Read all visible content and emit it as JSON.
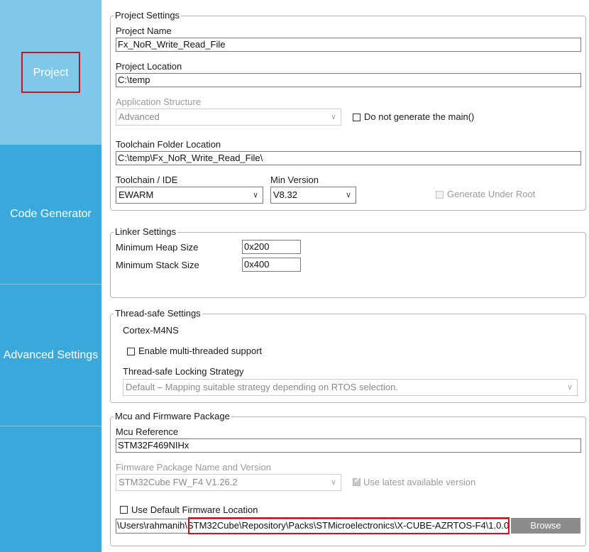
{
  "sidebar": {
    "items": [
      {
        "label": "Project",
        "active": true
      },
      {
        "label": "Code Generator",
        "active": false
      },
      {
        "label": "Advanced Settings",
        "active": false
      }
    ]
  },
  "project_settings": {
    "legend": "Project Settings",
    "project_name_label": "Project Name",
    "project_name_value": "Fx_NoR_Write_Read_File",
    "project_location_label": "Project Location",
    "project_location_value": "C:\\temp",
    "app_structure_label": "Application Structure",
    "app_structure_value": "Advanced",
    "do_not_generate_main_label": "Do not generate the main()",
    "toolchain_folder_label": "Toolchain Folder Location",
    "toolchain_folder_value": "C:\\temp\\Fx_NoR_Write_Read_File\\",
    "toolchain_ide_label": "Toolchain / IDE",
    "toolchain_ide_value": "EWARM",
    "min_version_label": "Min Version",
    "min_version_value": "V8.32",
    "generate_under_root_label": "Generate Under Root"
  },
  "linker_settings": {
    "legend": "Linker Settings",
    "heap_label": "Minimum Heap Size",
    "heap_value": "0x200",
    "stack_label": "Minimum Stack Size",
    "stack_value": "0x400"
  },
  "thread_safe_settings": {
    "legend": "Thread-safe Settings",
    "core_label": "Cortex-M4NS",
    "multithread_label": "Enable multi-threaded support",
    "locking_strategy_label": "Thread-safe Locking Strategy",
    "locking_strategy_value": "Default – Mapping suitable strategy depending on RTOS selection."
  },
  "mcu_firmware": {
    "legend": "Mcu and Firmware Package",
    "mcu_reference_label": "Mcu Reference",
    "mcu_reference_value": "STM32F469NIHx",
    "fw_package_label": "Firmware Package Name and Version",
    "fw_package_value": "STM32Cube FW_F4 V1.26.2",
    "use_latest_label": "Use latest available version",
    "use_default_location_label": "Use Default Firmware Location",
    "fw_location_prefix": "\\Users\\rahmanih\\",
    "fw_location_highlight": "STM32Cube\\Repository\\Packs\\STMicroelectronics\\X-CUBE-AZRTOS-F4\\1.0.0",
    "browse_label": "Browse"
  },
  "colors": {
    "sidebar_bg": "#39a9dc",
    "sidebar_active_bg": "#7fc8ea",
    "highlight_border": "#c8141e",
    "browse_bg": "#8c8c8c"
  }
}
